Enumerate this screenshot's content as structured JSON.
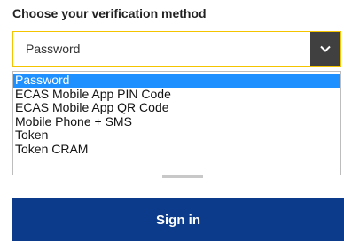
{
  "verification": {
    "heading": "Choose your verification method",
    "selected_value": "Password",
    "options": [
      "Password",
      "ECAS Mobile App PIN Code",
      "ECAS Mobile App QR Code",
      "Mobile Phone + SMS",
      "Token",
      "Token CRAM"
    ],
    "selected_index": 0
  },
  "actions": {
    "sign_in_label": "Sign in"
  },
  "colors": {
    "select_border": "#f5c400",
    "arrow_button": "#404040",
    "option_highlight": "#1e90ff",
    "primary_button": "#0d3b8c"
  },
  "icons": {
    "select_arrow": "chevron-down-icon"
  }
}
